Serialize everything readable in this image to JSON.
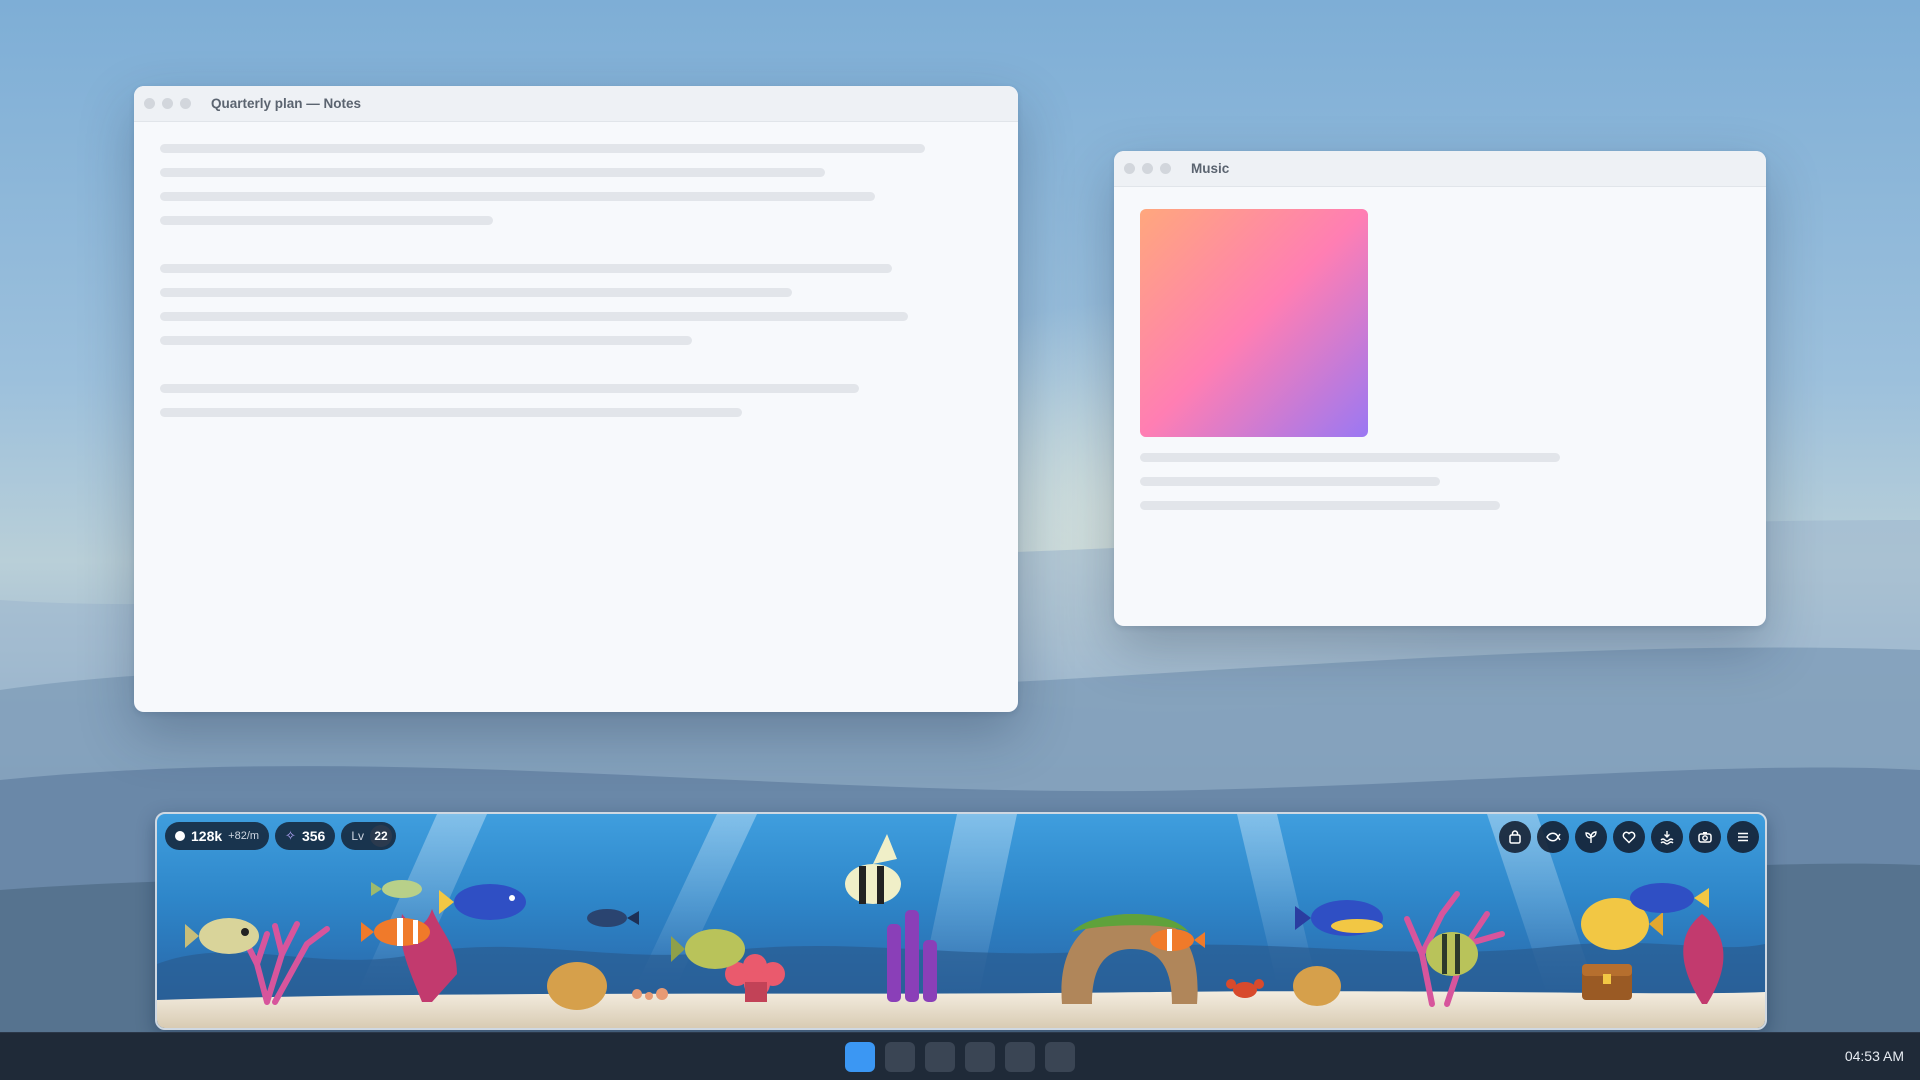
{
  "windows": {
    "notes": {
      "title": "Quarterly plan — Notes"
    },
    "music": {
      "title": "Music",
      "art_colors": [
        "#ffa77d",
        "#ff7eb3",
        "#9a78f3"
      ]
    }
  },
  "aquarium": {
    "coins": "128k",
    "coin_rate": "+82/m",
    "gems": "356",
    "level_label": "Lv",
    "level": "22",
    "tools": [
      "shop-icon",
      "fish-icon",
      "plant-icon",
      "heart-icon",
      "water-icon",
      "camera-icon",
      "menu-icon"
    ]
  },
  "taskbar": {
    "apps": [
      "app-1",
      "app-2",
      "app-3",
      "app-4",
      "app-5",
      "app-6"
    ],
    "active_app": 0,
    "clock": "04:53 AM"
  },
  "colors": {
    "accent": "#3b97f3",
    "taskbar": "#1f2a38",
    "water": "#2e86c9"
  }
}
